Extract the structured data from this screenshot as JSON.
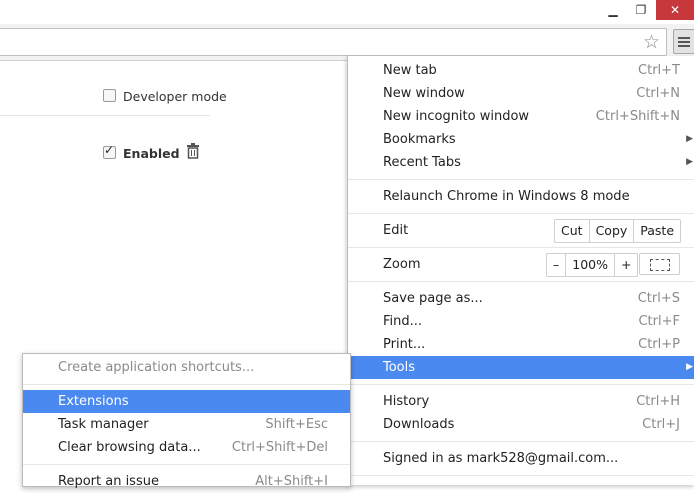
{
  "window": {
    "minimize_icon": "minimize-icon",
    "restore_icon": "restore-icon",
    "close_icon": "close-icon",
    "close_color": "#c7383d"
  },
  "toolbar": {
    "bookmark_icon": "star-icon",
    "menu_icon": "hamburger-menu-icon"
  },
  "page": {
    "developer_mode_label": "Developer mode",
    "developer_mode_checked": false,
    "extension_enabled_label": "Enabled",
    "extension_enabled_checked": true,
    "remove_icon": "trash-icon"
  },
  "menu": {
    "highlight_color": "#4a89f0",
    "new_tab": {
      "label": "New tab",
      "shortcut": "Ctrl+T"
    },
    "new_window": {
      "label": "New window",
      "shortcut": "Ctrl+N"
    },
    "new_incognito": {
      "label": "New incognito window",
      "shortcut": "Ctrl+Shift+N"
    },
    "bookmarks": {
      "label": "Bookmarks"
    },
    "recent_tabs": {
      "label": "Recent Tabs"
    },
    "relaunch": {
      "label": "Relaunch Chrome in Windows 8 mode"
    },
    "edit": {
      "label": "Edit",
      "cut": "Cut",
      "copy": "Copy",
      "paste": "Paste"
    },
    "zoom": {
      "label": "Zoom",
      "minus": "–",
      "level": "100%",
      "plus": "+"
    },
    "save_page": {
      "label": "Save page as...",
      "shortcut": "Ctrl+S"
    },
    "find": {
      "label": "Find...",
      "shortcut": "Ctrl+F"
    },
    "print": {
      "label": "Print...",
      "shortcut": "Ctrl+P"
    },
    "tools": {
      "label": "Tools"
    },
    "history": {
      "label": "History",
      "shortcut": "Ctrl+H"
    },
    "downloads": {
      "label": "Downloads",
      "shortcut": "Ctrl+J"
    },
    "signed_in": {
      "label": "Signed in as mark528@gmail.com..."
    }
  },
  "submenu": {
    "create_shortcuts": {
      "label": "Create application shortcuts..."
    },
    "extensions": {
      "label": "Extensions"
    },
    "task_manager": {
      "label": "Task manager",
      "shortcut": "Shift+Esc"
    },
    "clear_data": {
      "label": "Clear browsing data...",
      "shortcut": "Ctrl+Shift+Del"
    },
    "report_issue": {
      "label": "Report an issue",
      "shortcut": "Alt+Shift+I"
    }
  }
}
